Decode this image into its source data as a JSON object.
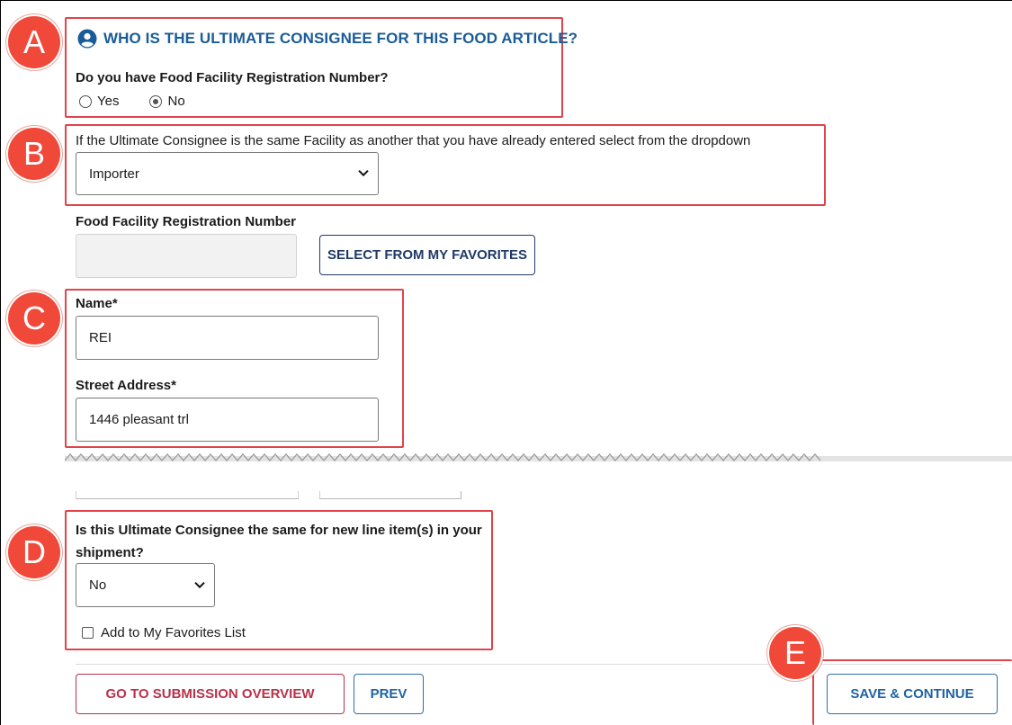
{
  "markers": [
    "A",
    "B",
    "C",
    "D",
    "E"
  ],
  "section_a": {
    "heading": "WHO IS THE ULTIMATE CONSIGNEE FOR THIS FOOD ARTICLE?",
    "heading_icon": "user-circle-icon",
    "question": "Do you have Food Facility Registration Number?",
    "options": [
      {
        "label": "Yes",
        "checked": false
      },
      {
        "label": "No",
        "checked": true
      }
    ]
  },
  "section_b": {
    "question": "If the Ultimate Consignee is the same Facility as another that you have already entered select from the dropdown",
    "selected": "Importer"
  },
  "registration": {
    "label": "Food Facility Registration Number",
    "value": "",
    "favorites_button": "SELECT FROM MY FAVORITES"
  },
  "section_c": {
    "name_label": "Name*",
    "name_value": "REI",
    "street_label": "Street Address*",
    "street_value": "1446 pleasant trl"
  },
  "section_d": {
    "question": "Is this Ultimate Consignee the same for new line item(s) in your shipment?",
    "selected": "No",
    "favorites_checkbox": "Add to My Favorites List",
    "favorites_checked": false
  },
  "footer": {
    "overview_button": "GO TO SUBMISSION OVERVIEW",
    "prev_button": "PREV",
    "save_button": "SAVE & CONTINUE"
  },
  "colors": {
    "highlight": "#e0444a",
    "badge": "#f0493a",
    "heading": "#1a5c98",
    "danger_button": "#b8324a",
    "primary_button": "#1f63a3"
  }
}
